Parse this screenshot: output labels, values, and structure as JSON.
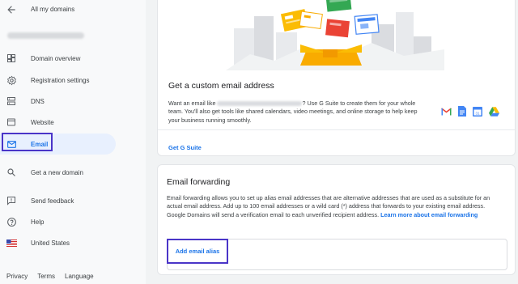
{
  "sidebar": {
    "back_label": "All my domains",
    "items": [
      {
        "label": "Domain overview",
        "icon": "dashboard-icon"
      },
      {
        "label": "Registration settings",
        "icon": "gear-icon"
      },
      {
        "label": "DNS",
        "icon": "dns-icon"
      },
      {
        "label": "Website",
        "icon": "website-icon"
      },
      {
        "label": "Email",
        "icon": "mail-icon"
      },
      {
        "label": "Get a new domain",
        "icon": "search-icon"
      },
      {
        "label": "Send feedback",
        "icon": "feedback-icon"
      },
      {
        "label": "Help",
        "icon": "help-icon"
      },
      {
        "label": "United States",
        "icon": "us-flag-icon"
      }
    ],
    "footer": {
      "privacy": "Privacy",
      "terms": "Terms",
      "language": "Language"
    }
  },
  "gsuite_card": {
    "title": "Get a custom email address",
    "text_before": "Want an email like",
    "text_after": "? Use G Suite to create them for your whole team. You'll also get tools like shared calendars, video meetings, and online storage to help keep your business running smoothly.",
    "link": "Get G Suite"
  },
  "forwarding_card": {
    "title": "Email forwarding",
    "text": "Email forwarding allows you to set up alias email addresses that are alternative addresses that are used as a substitute for an actual email address. Add up to 100 email addresses or a wild card (*) address that forwards to your existing email address. Google Domains will send a verification email to each unverified recipient address.",
    "learn_more": "Learn more about email forwarding",
    "add_alias": "Add email alias"
  },
  "colors": {
    "accent": "#1a73e8",
    "highlight": "#4a35c8",
    "active_bg": "#e8f0fe"
  }
}
